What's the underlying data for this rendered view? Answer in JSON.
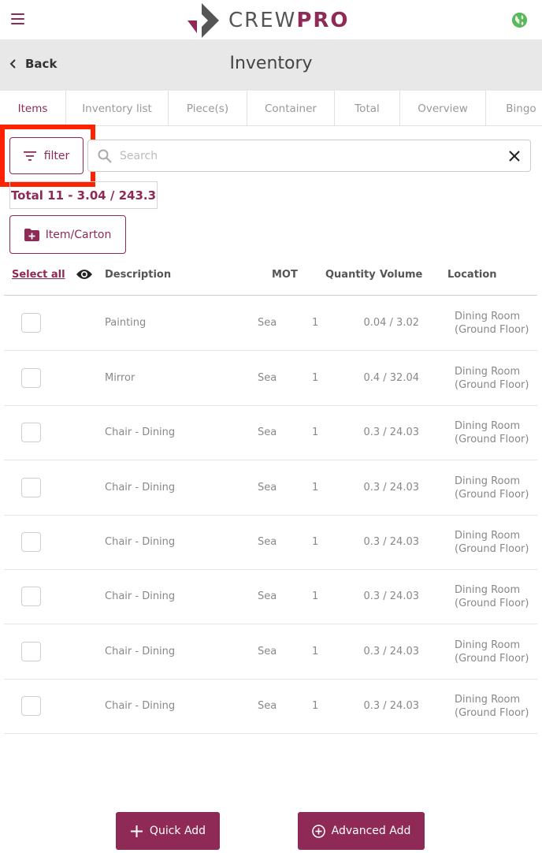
{
  "app": {
    "logo_left": "CREW",
    "logo_right": "PRO"
  },
  "header": {
    "back_label": "Back",
    "title": "Inventory"
  },
  "tabs": [
    {
      "label": "Items",
      "active": true
    },
    {
      "label": "Inventory list"
    },
    {
      "label": "Piece(s)"
    },
    {
      "label": "Container"
    },
    {
      "label": "Total"
    },
    {
      "label": "Overview"
    },
    {
      "label": "Bingo"
    }
  ],
  "toolbar": {
    "filter_label": "filter",
    "search_placeholder": "Search",
    "search_value": ""
  },
  "summary": {
    "total_text": "Total 11 - 3.04 / 243.3"
  },
  "actions": {
    "add_item_label": "Item/Carton",
    "quick_add_label": "Quick Add",
    "advanced_add_label": "Advanced Add"
  },
  "table": {
    "select_all_label": "Select all",
    "columns": {
      "description": "Description",
      "mot": "MOT",
      "quantity": "Quantity",
      "volume": "Volume",
      "location": "Location"
    },
    "rows": [
      {
        "description": "Painting",
        "mot": "Sea",
        "quantity": "1",
        "volume": "0.04 / 3.02",
        "location_line1": "Dining Room",
        "location_line2": "(Ground Floor)"
      },
      {
        "description": "Mirror",
        "mot": "Sea",
        "quantity": "1",
        "volume": "0.4 / 32.04",
        "location_line1": "Dining Room",
        "location_line2": "(Ground Floor)"
      },
      {
        "description": "Chair - Dining",
        "mot": "Sea",
        "quantity": "1",
        "volume": "0.3 / 24.03",
        "location_line1": "Dining Room",
        "location_line2": "(Ground Floor)"
      },
      {
        "description": "Chair - Dining",
        "mot": "Sea",
        "quantity": "1",
        "volume": "0.3 / 24.03",
        "location_line1": "Dining Room",
        "location_line2": "(Ground Floor)"
      },
      {
        "description": "Chair - Dining",
        "mot": "Sea",
        "quantity": "1",
        "volume": "0.3 / 24.03",
        "location_line1": "Dining Room",
        "location_line2": "(Ground Floor)"
      },
      {
        "description": "Chair - Dining",
        "mot": "Sea",
        "quantity": "1",
        "volume": "0.3 / 24.03",
        "location_line1": "Dining Room",
        "location_line2": "(Ground Floor)"
      },
      {
        "description": "Chair - Dining",
        "mot": "Sea",
        "quantity": "1",
        "volume": "0.3 / 24.03",
        "location_line1": "Dining Room",
        "location_line2": "(Ground Floor)"
      },
      {
        "description": "Chair - Dining",
        "mot": "Sea",
        "quantity": "1",
        "volume": "0.3 / 24.03",
        "location_line1": "Dining Room",
        "location_line2": "(Ground Floor)"
      }
    ]
  },
  "colors": {
    "brand": "#8e2a55",
    "highlight": "#ff2200",
    "header_bg": "#e8e8e8",
    "globe": "#5cb85c"
  },
  "icons": {
    "menu": "hamburger-icon",
    "globe": "globe-icon",
    "back": "chevron-left-icon",
    "filter": "filter-icon",
    "search": "search-icon",
    "clear": "close-icon",
    "add_item": "folder-plus-icon",
    "visibility": "eye-icon",
    "quick_add": "plus-icon",
    "advanced_add": "plus-circle-icon"
  }
}
